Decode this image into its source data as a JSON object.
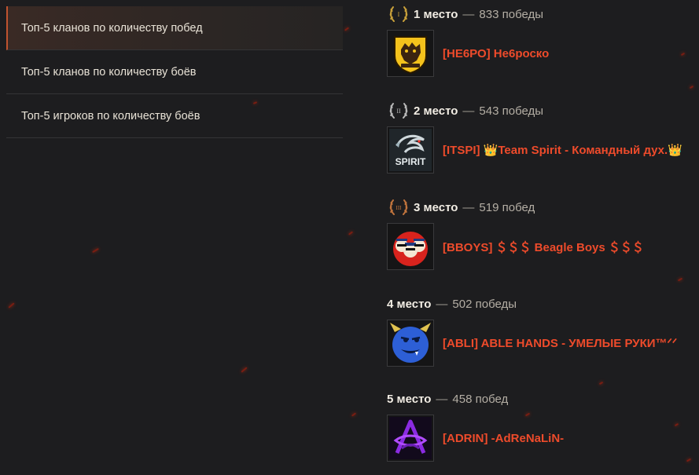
{
  "sidebar": {
    "items": [
      {
        "label": "Топ-5 кланов по количеству побед",
        "active": true
      },
      {
        "label": "Топ-5 кланов по количеству боёв",
        "active": false
      },
      {
        "label": "Топ-5 игроков по количеству боёв",
        "active": false
      }
    ]
  },
  "ranking": [
    {
      "place": "1 место",
      "sep": "—",
      "count": "833 победы",
      "clan": "[НЕ6РО] Не6роско",
      "laurel": "gold-laurel-icon",
      "emblem": "yellow-shield-emblem"
    },
    {
      "place": "2 место",
      "sep": "—",
      "count": "543 победы",
      "clan": "[ITSPI] 👑Team Spirit - Командный дух.👑",
      "laurel": "silver-laurel-icon",
      "emblem": "spirit-dragon-emblem"
    },
    {
      "place": "3 место",
      "sep": "—",
      "count": "519 побед",
      "clan": "[BBOYS] ＄＄＄ Beagle Boys ＄＄＄",
      "laurel": "bronze-laurel-icon",
      "emblem": "beagle-boys-emblem"
    },
    {
      "place": "4 место",
      "sep": "—",
      "count": "502 победы",
      "clan": "[ABLI] ABLE HANDS - УМЕЛЫЕ РУКИ™ᐟᐟ",
      "laurel": null,
      "emblem": "blue-monster-emblem"
    },
    {
      "place": "5 место",
      "sep": "—",
      "count": "458 побед",
      "clan": "[ADRIN] -AdReNaLiN-",
      "laurel": null,
      "emblem": "purple-logo-emblem"
    }
  ],
  "colors": {
    "background": "#1d1d1f",
    "clan_name": "#ee4b2b",
    "active_accent": "#c0532f",
    "gold": "#c9a13a",
    "silver": "#b8b8b8",
    "bronze": "#c0743d"
  }
}
